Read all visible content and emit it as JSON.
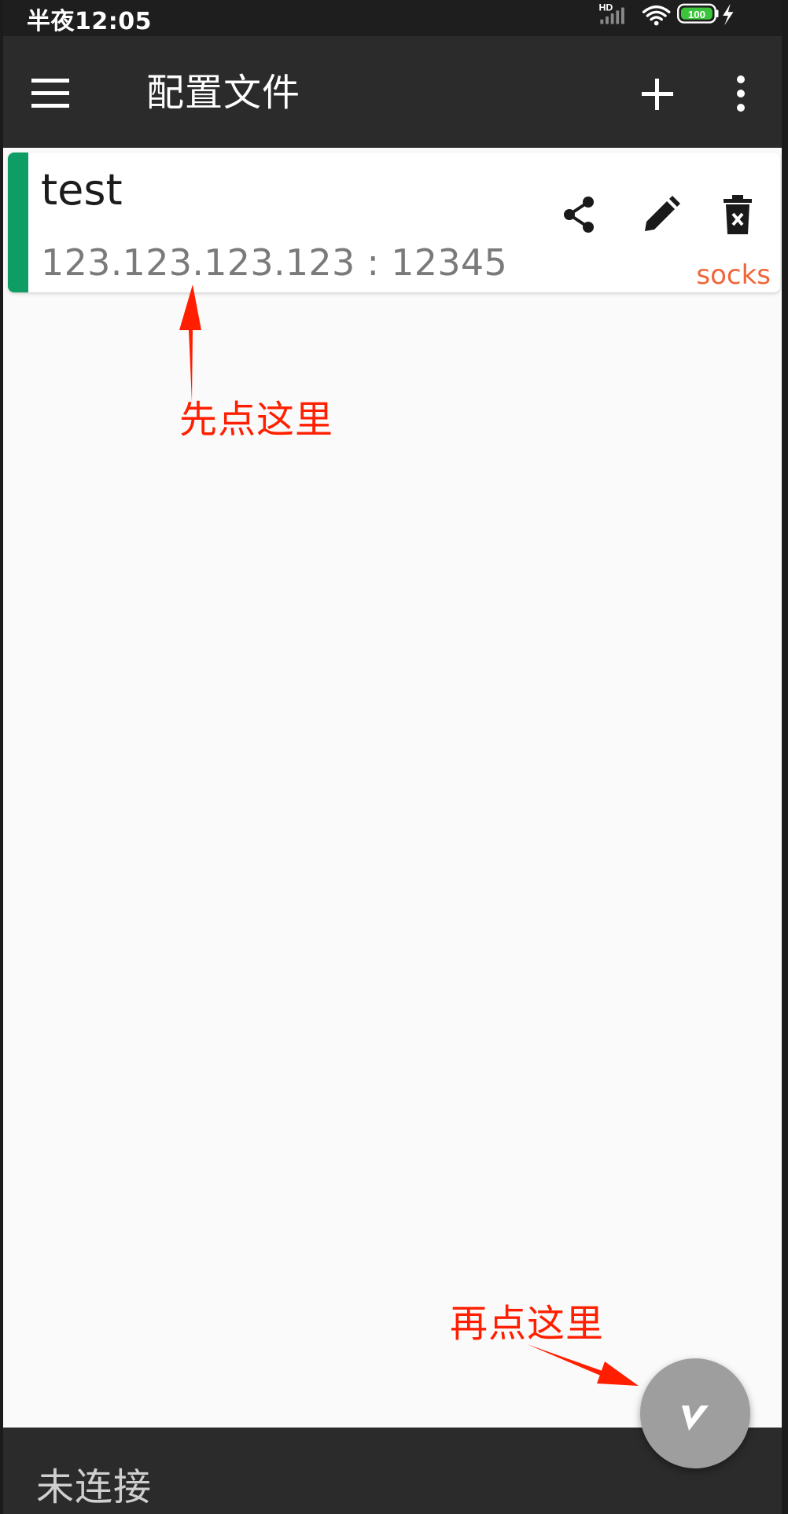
{
  "status_bar": {
    "time": "半夜12:05",
    "network_label": "HD",
    "battery_level": "100"
  },
  "toolbar": {
    "title": "配置文件",
    "icons": [
      "menu-icon",
      "add-icon",
      "more-vert-icon"
    ]
  },
  "profiles": [
    {
      "name": "test",
      "address": "123.123.123.123 : 12345",
      "type": "socks",
      "accent_color": "#0f9d65",
      "actions": [
        "share-icon",
        "edit-icon",
        "delete-icon"
      ]
    }
  ],
  "annotations": {
    "first": "先点这里",
    "second": "再点这里",
    "color": "#ff1f00"
  },
  "bottom_bar": {
    "status": "未连接"
  },
  "fab": {
    "icon": "v-logo-icon",
    "color": "#9e9e9e"
  }
}
